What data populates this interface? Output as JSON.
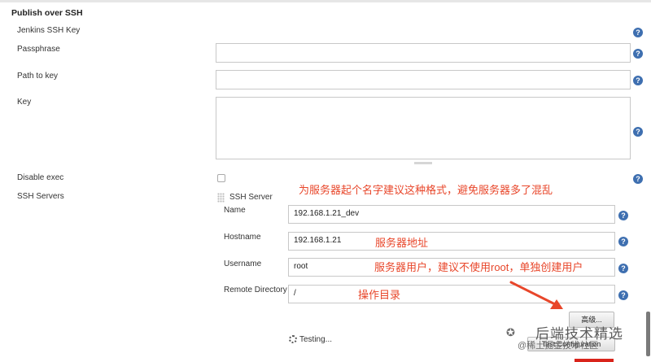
{
  "section": {
    "title": "Publish over SSH"
  },
  "fields": {
    "jenkins_ssh_key": {
      "label": "Jenkins SSH Key"
    },
    "passphrase": {
      "label": "Passphrase",
      "value": ""
    },
    "path_to_key": {
      "label": "Path to key",
      "value": ""
    },
    "key": {
      "label": "Key",
      "value": ""
    },
    "disable_exec": {
      "label": "Disable exec",
      "checked": false
    },
    "ssh_servers": {
      "label": "SSH Servers"
    }
  },
  "ssh_server": {
    "header": "SSH Server",
    "name": {
      "label": "Name",
      "value": "192.168.1.21_dev"
    },
    "hostname": {
      "label": "Hostname",
      "value": "192.168.1.21"
    },
    "username": {
      "label": "Username",
      "value": "root"
    },
    "remote_directory": {
      "label": "Remote Directory",
      "value": "/"
    },
    "advanced_button": "高级...",
    "test_button": "Test Configuration",
    "testing_status": "Testing..."
  },
  "annotations": {
    "naming_tip": "为服务器起个名字建议这种格式，避免服务器多了混乱",
    "hostname_tip": "服务器地址",
    "username_tip": "服务器用户，建议不使用root，单独创建用户",
    "directory_tip": "操作目录"
  },
  "watermark": {
    "text": "后端技术精选",
    "sub": "@稀土掘金技术社区"
  },
  "help_symbol": "?",
  "colors": {
    "annotation": "#e8462a",
    "help": "#3e6fb0",
    "arrow": "#e8462a"
  },
  "icons": [
    "help-icon",
    "drag-handle-icon",
    "spinner-icon",
    "wechat-icon",
    "arrow-icon"
  ]
}
